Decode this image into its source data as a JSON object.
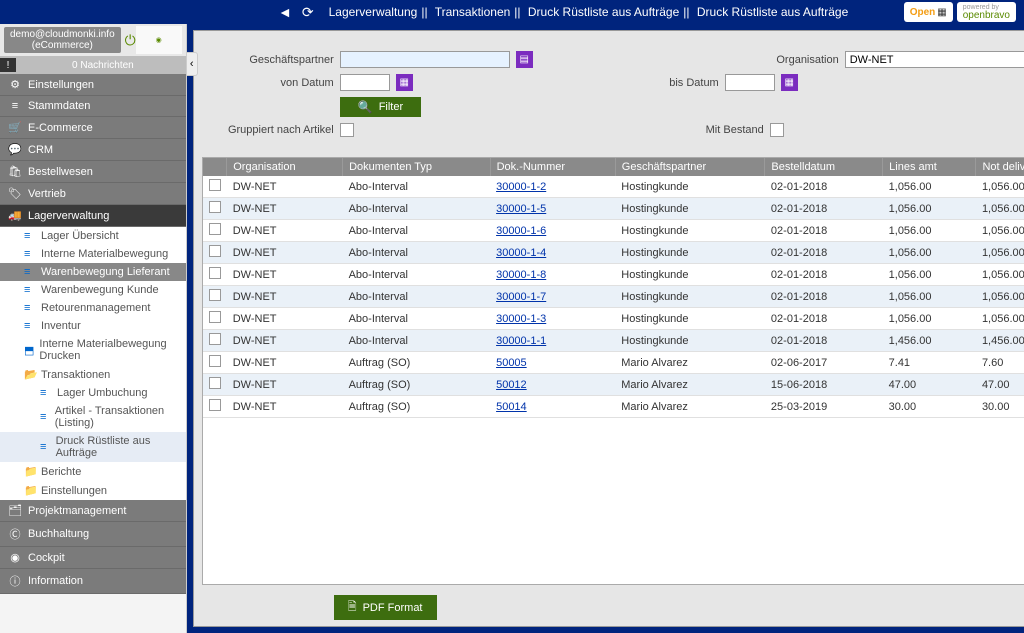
{
  "topbar": {
    "breadcrumb": [
      "Lagerverwaltung",
      "Transaktionen",
      "Druck Rüstliste aus Aufträge",
      "Druck Rüstliste aus Aufträge"
    ],
    "logo_open": "Open",
    "logo_ob_powered": "powered by",
    "logo_ob": "openbravo"
  },
  "sidebar": {
    "user": "demo@cloudmonki.info (eCommerce)",
    "messages": "0  Nachrichten",
    "menu": [
      {
        "icon": "⚙",
        "label": "Einstellungen"
      },
      {
        "icon": "≡",
        "label": "Stammdaten"
      },
      {
        "icon": "🛒",
        "label": "E-Commerce"
      },
      {
        "icon": "💬",
        "label": "CRM"
      },
      {
        "icon": "🛍",
        "label": "Bestellwesen"
      },
      {
        "icon": "🏷",
        "label": "Vertrieb"
      }
    ],
    "active_label": "Lagerverwaltung",
    "sub": [
      {
        "icon": "≡",
        "label": "Lager Übersicht"
      },
      {
        "icon": "≡",
        "label": "Interne Materialbewegung"
      },
      {
        "icon": "≡",
        "label": "Warenbewegung Lieferant",
        "sel": true
      },
      {
        "icon": "≡",
        "label": "Warenbewegung Kunde"
      },
      {
        "icon": "≡",
        "label": "Retourenmanagement"
      },
      {
        "icon": "≡",
        "label": "Inventur"
      },
      {
        "icon": "⬒",
        "label": "Interne Materialbewegung Drucken"
      },
      {
        "icon": "📂",
        "label": "Transaktionen",
        "folder": true
      },
      {
        "icon": "≡",
        "label": "Lager Umbuchung",
        "lvl": 2
      },
      {
        "icon": "≡",
        "label": "Artikel - Transaktionen (Listing)",
        "lvl": 2
      },
      {
        "icon": "≡",
        "label": "Druck Rüstliste aus Aufträge",
        "lvl": 2,
        "selblue": true
      },
      {
        "icon": "📁",
        "label": "Berichte",
        "folder": true
      },
      {
        "icon": "📁",
        "label": "Einstellungen",
        "folder": true
      }
    ],
    "menu2": [
      {
        "icon": "🗂",
        "label": "Projektmanagement"
      },
      {
        "icon": "Ⓒ",
        "label": "Buchhaltung"
      },
      {
        "icon": "◉",
        "label": "Cockpit"
      },
      {
        "icon": "ⓘ",
        "label": "Information"
      }
    ]
  },
  "filters": {
    "bp_label": "Geschäftspartner",
    "from_label": "von Datum",
    "org_label": "Organisation",
    "org_value": "DW-NET",
    "to_label": "bis Datum",
    "filter_btn": "Filter",
    "group_label": "Gruppiert nach Artikel",
    "stock_label": "Mit Bestand",
    "pdf_btn": "PDF Format"
  },
  "table": {
    "headers": [
      "Organisation",
      "Dokumenten Typ",
      "Dok.-Nummer",
      "Geschäftspartner",
      "Bestelldatum",
      "Lines amt",
      "Not delivery"
    ],
    "rows": [
      [
        "DW-NET",
        "Abo-Interval",
        "30000-1-2",
        "Hostingkunde",
        "02-01-2018",
        "1,056.00",
        "1,056.00"
      ],
      [
        "DW-NET",
        "Abo-Interval",
        "30000-1-5",
        "Hostingkunde",
        "02-01-2018",
        "1,056.00",
        "1,056.00"
      ],
      [
        "DW-NET",
        "Abo-Interval",
        "30000-1-6",
        "Hostingkunde",
        "02-01-2018",
        "1,056.00",
        "1,056.00"
      ],
      [
        "DW-NET",
        "Abo-Interval",
        "30000-1-4",
        "Hostingkunde",
        "02-01-2018",
        "1,056.00",
        "1,056.00"
      ],
      [
        "DW-NET",
        "Abo-Interval",
        "30000-1-8",
        "Hostingkunde",
        "02-01-2018",
        "1,056.00",
        "1,056.00"
      ],
      [
        "DW-NET",
        "Abo-Interval",
        "30000-1-7",
        "Hostingkunde",
        "02-01-2018",
        "1,056.00",
        "1,056.00"
      ],
      [
        "DW-NET",
        "Abo-Interval",
        "30000-1-3",
        "Hostingkunde",
        "02-01-2018",
        "1,056.00",
        "1,056.00"
      ],
      [
        "DW-NET",
        "Abo-Interval",
        "30000-1-1",
        "Hostingkunde",
        "02-01-2018",
        "1,456.00",
        "1,456.00"
      ],
      [
        "DW-NET",
        "Auftrag (SO)",
        "50005",
        "Mario Alvarez",
        "02-06-2017",
        "7.41",
        "7.60"
      ],
      [
        "DW-NET",
        "Auftrag (SO)",
        "50012",
        "Mario Alvarez",
        "15-06-2018",
        "47.00",
        "47.00"
      ],
      [
        "DW-NET",
        "Auftrag (SO)",
        "50014",
        "Mario Alvarez",
        "25-03-2019",
        "30.00",
        "30.00"
      ]
    ]
  }
}
